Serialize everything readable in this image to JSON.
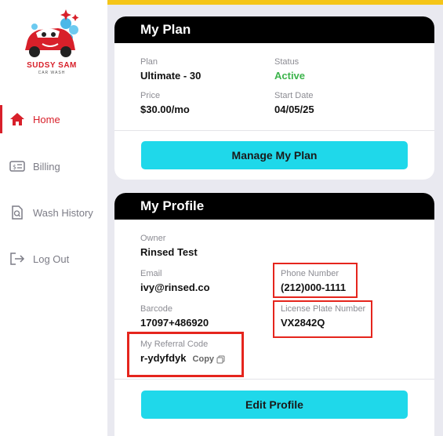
{
  "brand": {
    "name": "SUDSY SAM",
    "tagline": "CAR WASH"
  },
  "nav": {
    "home": "Home",
    "billing": "Billing",
    "wash_history": "Wash History",
    "logout": "Log Out"
  },
  "plan": {
    "title": "My Plan",
    "plan_label": "Plan",
    "plan_value": "Ultimate - 30",
    "status_label": "Status",
    "status_value": "Active",
    "price_label": "Price",
    "price_value": "$30.00/mo",
    "start_label": "Start Date",
    "start_value": "04/05/25",
    "manage_button": "Manage My Plan"
  },
  "profile": {
    "title": "My Profile",
    "owner_label": "Owner",
    "owner_value": "Rinsed Test",
    "email_label": "Email",
    "email_value": "ivy@rinsed.co",
    "phone_label": "Phone Number",
    "phone_value": "(212)000-1111",
    "barcode_label": "Barcode",
    "barcode_value": "17097+486920",
    "plate_label": "License Plate Number",
    "plate_value": "VX2842Q",
    "referral_label": "My Referral Code",
    "referral_value": "r-ydyfdyk",
    "copy_label": "Copy",
    "edit_button": "Edit Profile"
  },
  "colors": {
    "accent": "#d8202a",
    "button": "#1fd8ea",
    "status_active": "#3cb44b",
    "topbar": "#f5c518"
  }
}
